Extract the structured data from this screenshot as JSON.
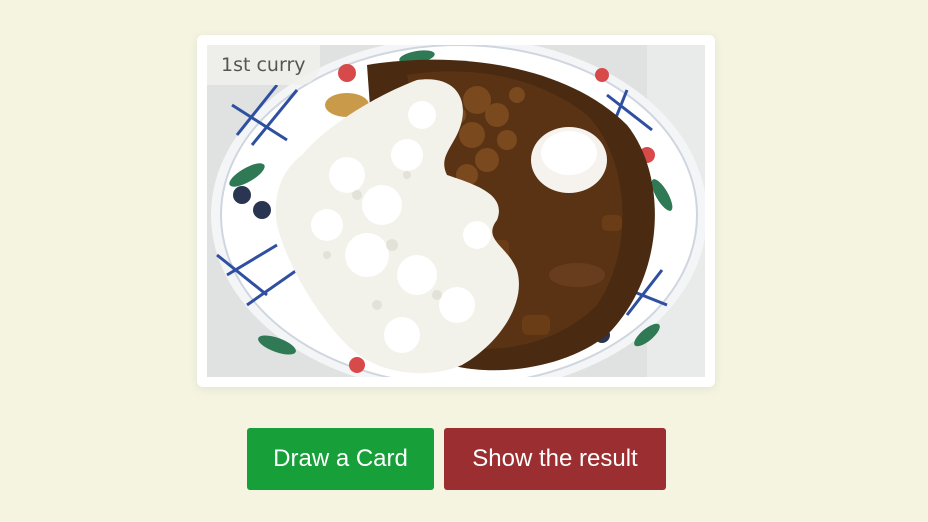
{
  "card": {
    "badge": "1st curry",
    "image": {
      "description_icon": "curry-rice-photo"
    }
  },
  "buttons": {
    "draw_label": "Draw a Card",
    "result_label": "Show the result"
  },
  "colors": {
    "background": "#f5f4e1",
    "draw_button": "#179f39",
    "result_button": "#9b2e30",
    "badge_text": "#555555"
  }
}
